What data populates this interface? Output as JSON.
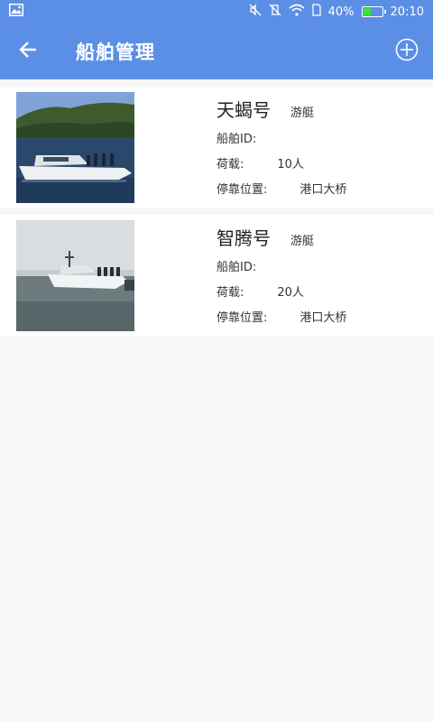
{
  "status_bar": {
    "battery_percent": "40%",
    "battery_level": 0.4,
    "time": "20:10",
    "icons": [
      "image-icon",
      "mute-icon",
      "vibrate-off-icon",
      "wifi-icon",
      "sim-icon",
      "battery-icon"
    ]
  },
  "app_bar": {
    "title": "船舶管理",
    "back_icon": "back-arrow-icon",
    "add_icon": "add-circle-icon"
  },
  "colors": {
    "primary": "#5b8fe6",
    "background": "#f7f7f9",
    "card": "#ffffff",
    "battery": "#3be03b"
  },
  "boats": [
    {
      "name": "天蝎号",
      "type": "游艇",
      "id_label": "船舶ID:",
      "id_value": "",
      "capacity_label": "荷载:",
      "capacity_value": "10人",
      "location_label": "停靠位置:",
      "location_value": "港口大桥"
    },
    {
      "name": "智腾号",
      "type": "游艇",
      "id_label": "船舶ID:",
      "id_value": "",
      "capacity_label": "荷载:",
      "capacity_value": "20人",
      "location_label": "停靠位置:",
      "location_value": "港口大桥"
    }
  ]
}
